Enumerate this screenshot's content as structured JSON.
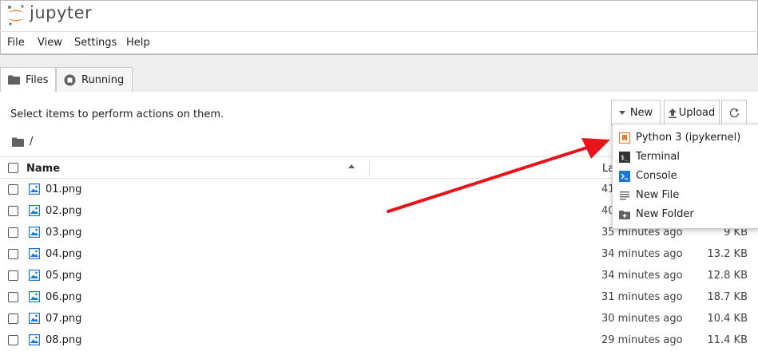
{
  "app": {
    "brand": "jupyter"
  },
  "menubar": {
    "items": [
      "File",
      "View",
      "Settings",
      "Help"
    ]
  },
  "tabs": [
    {
      "label": "Files"
    },
    {
      "label": "Running"
    }
  ],
  "toolbar": {
    "hint": "Select items to perform actions on them.",
    "new_label": "New",
    "upload_label": "Upload"
  },
  "breadcrumb": {
    "path": "/"
  },
  "table": {
    "col_name": "Name",
    "col_last_modified_partial": "La",
    "rows": [
      {
        "name": "01.png",
        "modified": "41",
        "size": ""
      },
      {
        "name": "02.png",
        "modified": "40",
        "size": ""
      },
      {
        "name": "03.png",
        "modified": "35 minutes ago",
        "size": "9 KB"
      },
      {
        "name": "04.png",
        "modified": "34 minutes ago",
        "size": "13.2 KB"
      },
      {
        "name": "05.png",
        "modified": "34 minutes ago",
        "size": "12.8 KB"
      },
      {
        "name": "06.png",
        "modified": "31 minutes ago",
        "size": "18.7 KB"
      },
      {
        "name": "07.png",
        "modified": "30 minutes ago",
        "size": "10.4 KB"
      },
      {
        "name": "08.png",
        "modified": "29 minutes ago",
        "size": "11.4 KB"
      }
    ]
  },
  "new_menu": {
    "items": [
      {
        "label": "Python 3 (ipykernel)",
        "icon": "python-notebook-icon"
      },
      {
        "label": "Terminal",
        "icon": "terminal-icon"
      },
      {
        "label": "Console",
        "icon": "console-icon"
      },
      {
        "label": "New File",
        "icon": "text-file-icon"
      },
      {
        "label": "New Folder",
        "icon": "new-folder-icon"
      }
    ]
  },
  "colors": {
    "accent_orange": "#f37726",
    "image_icon_blue": "#1976d2",
    "annotation_arrow": "#e8141b"
  }
}
